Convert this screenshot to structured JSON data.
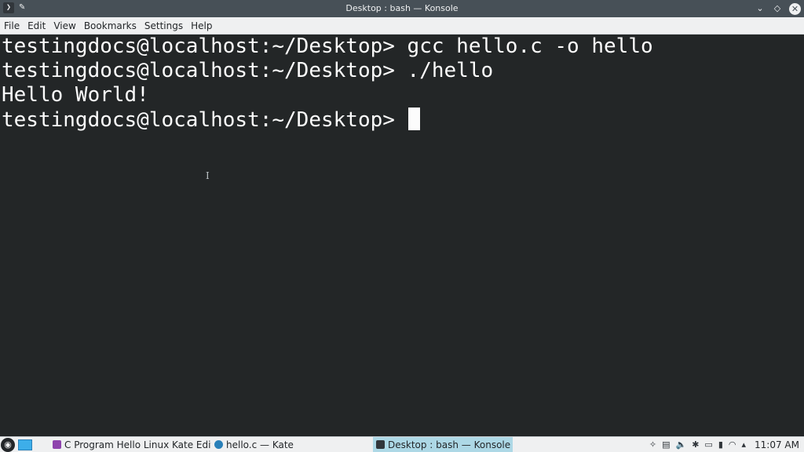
{
  "window": {
    "title": "Desktop : bash — Konsole",
    "app_icon_glyph": "❯",
    "pin_glyph": "✎",
    "minimize_glyph": "⌄",
    "maximize_glyph": "◇",
    "close_glyph": "✕"
  },
  "menu": {
    "items": [
      "File",
      "Edit",
      "View",
      "Bookmarks",
      "Settings",
      "Help"
    ]
  },
  "terminal": {
    "lines": [
      "testingdocs@localhost:~/Desktop> gcc hello.c -o hello",
      "testingdocs@localhost:~/Desktop> ./hello",
      "Hello World!",
      "testingdocs@localhost:~/Desktop> "
    ],
    "ibeam_glyph": "I"
  },
  "taskbar": {
    "launcher_glyph": "◉",
    "tasks": [
      {
        "label": "C Program Hello Linux Kate Edito...",
        "icon_color": "#8e44ad",
        "active": false
      },
      {
        "label": "hello.c  — Kate",
        "icon_color": "#2980b9",
        "active": false
      },
      {
        "label": "Desktop : bash — Konsole",
        "icon_color": "#31363b",
        "active": true
      }
    ],
    "tray_icons": [
      "✧",
      "▤",
      "🔈",
      "✱",
      "▭",
      "▮",
      "◠",
      "▴"
    ],
    "clock": "11:07 AM"
  },
  "colors": {
    "terminal_bg": "#232627",
    "terminal_fg": "#fcfcfc",
    "titlebar_bg": "#475057",
    "active_task": "#add8e6"
  }
}
